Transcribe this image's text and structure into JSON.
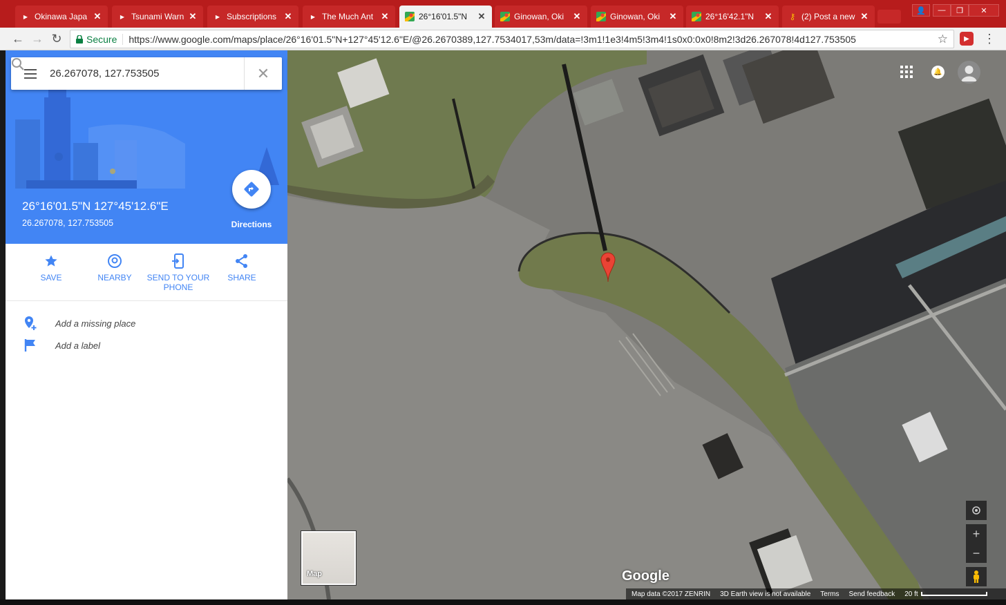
{
  "browser": {
    "tabs": [
      {
        "title": "Okinawa Japa",
        "favicon": "youtube-icon",
        "active": false
      },
      {
        "title": "Tsunami Warn",
        "favicon": "youtube-icon",
        "active": false
      },
      {
        "title": "Subscriptions",
        "favicon": "youtube-icon",
        "active": false
      },
      {
        "title": "The Much Ant",
        "favicon": "youtube-icon",
        "active": false
      },
      {
        "title": "26°16'01.5\"N",
        "favicon": "maps-icon",
        "active": true
      },
      {
        "title": "Ginowan, Oki",
        "favicon": "maps-icon",
        "active": false
      },
      {
        "title": "Ginowan, Oki",
        "favicon": "maps-icon",
        "active": false
      },
      {
        "title": "26°16'42.1\"N",
        "favicon": "maps-icon",
        "active": false
      },
      {
        "title": "(2) Post a new",
        "favicon": "key-icon",
        "active": false
      }
    ],
    "secure_label": "Secure",
    "url": "https://www.google.com/maps/place/26°16'01.5\"N+127°45'12.6\"E/@26.2670389,127.7534017,53m/data=!3m1!1e3!4m5!3m4!1s0x0:0x0!8m2!3d26.267078!4d127.753505"
  },
  "search": {
    "value": "26.267078, 127.753505"
  },
  "place": {
    "title": "26°16'01.5\"N 127°45'12.6\"E",
    "subtitle": "26.267078, 127.753505",
    "directions_label": "Directions"
  },
  "actions": [
    {
      "label": "SAVE",
      "icon": "star-icon"
    },
    {
      "label": "NEARBY",
      "icon": "nearby-icon"
    },
    {
      "label": "SEND TO YOUR PHONE",
      "icon": "send-to-phone-icon"
    },
    {
      "label": "SHARE",
      "icon": "share-icon"
    }
  ],
  "extras": [
    {
      "label": "Add a missing place",
      "icon": "add-place-icon"
    },
    {
      "label": "Add a label",
      "icon": "flag-icon"
    }
  ],
  "map": {
    "minimap_label": "Map",
    "logo": "Google",
    "footer": {
      "map_data": "Map data ©2017 ZENRIN",
      "earth_note": "3D Earth view is not available",
      "terms": "Terms",
      "feedback": "Send feedback",
      "scale": "20 ft"
    }
  },
  "colors": {
    "brand_blue": "#4285f4",
    "tab_red": "#c62828",
    "marker_red": "#ea4335"
  }
}
